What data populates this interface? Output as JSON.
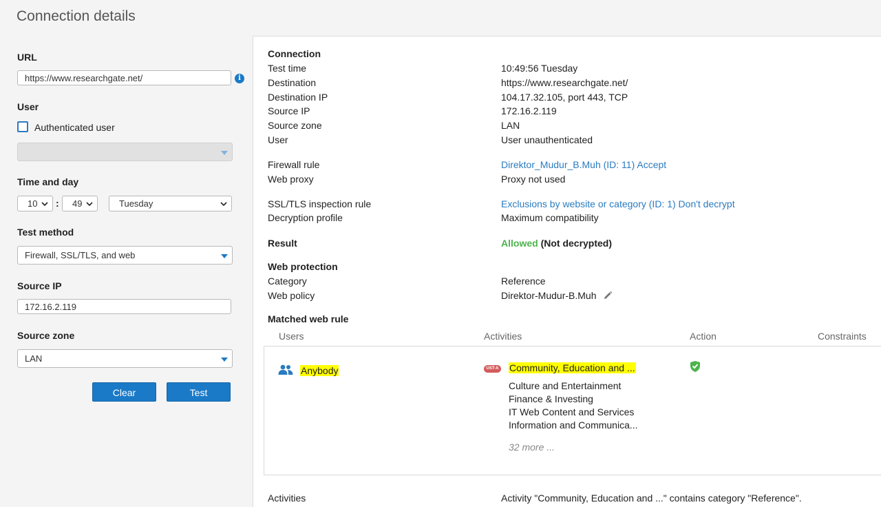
{
  "title": "Connection details",
  "form": {
    "url_label": "URL",
    "url_value": "https://www.researchgate.net/",
    "user_label": "User",
    "auth_user_label": "Authenticated user",
    "auth_user_checked": false,
    "user_select_value": "",
    "time_label": "Time and day",
    "hour": "10",
    "minute": "49",
    "day": "Tuesday",
    "test_method_label": "Test method",
    "test_method_value": "Firewall, SSL/TLS, and web",
    "source_ip_label": "Source IP",
    "source_ip_value": "172.16.2.119",
    "source_zone_label": "Source zone",
    "source_zone_value": "LAN",
    "clear_label": "Clear",
    "test_label": "Test"
  },
  "details": {
    "connection_heading": "Connection",
    "test_time_label": "Test time",
    "test_time": "10:49:56 Tuesday",
    "destination_label": "Destination",
    "destination": "https://www.researchgate.net/",
    "destination_ip_label": "Destination IP",
    "destination_ip": "104.17.32.105, port 443, TCP",
    "source_ip_label": "Source IP",
    "source_ip": "172.16.2.119",
    "source_zone_label": "Source zone",
    "source_zone": "LAN",
    "user_label": "User",
    "user": "User unauthenticated",
    "firewall_rule_label": "Firewall rule",
    "firewall_rule": "Direktor_Mudur_B.Muh (ID: 11) Accept",
    "web_proxy_label": "Web proxy",
    "web_proxy": "Proxy not used",
    "ssl_rule_label": "SSL/TLS inspection rule",
    "ssl_rule": "Exclusions by website or category (ID: 1) Don't decrypt",
    "decryption_profile_label": "Decryption profile",
    "decryption_profile": "Maximum compatibility",
    "result_label": "Result",
    "result_status": "Allowed",
    "result_detail": "(Not decrypted)",
    "web_protection_heading": "Web protection",
    "category_label": "Category",
    "category": "Reference",
    "web_policy_label": "Web policy",
    "web_policy": "Direktor-Mudur-B.Muh",
    "matched_rule_heading": "Matched web rule",
    "activities_label": "Activities",
    "activities_text": "Activity \"Community, Education and ...\" contains category \"Reference\"."
  },
  "rule_table": {
    "headers": {
      "users": "Users",
      "activities": "Activities",
      "action": "Action",
      "constraints": "Constraints"
    },
    "user": "Anybody",
    "badge": "UST-A",
    "activity_highlight": "Community, Education and ...",
    "activities": [
      "Culture and Entertainment",
      "Finance & Investing",
      "IT Web Content and Services",
      "Information and Communica..."
    ],
    "more": "32 more ...",
    "action_icon": "shield-check-icon"
  },
  "colors": {
    "accent": "#1a7ac7",
    "link": "#2a7bc0",
    "allowed": "#4cb34c",
    "highlight": "#ffff00"
  }
}
